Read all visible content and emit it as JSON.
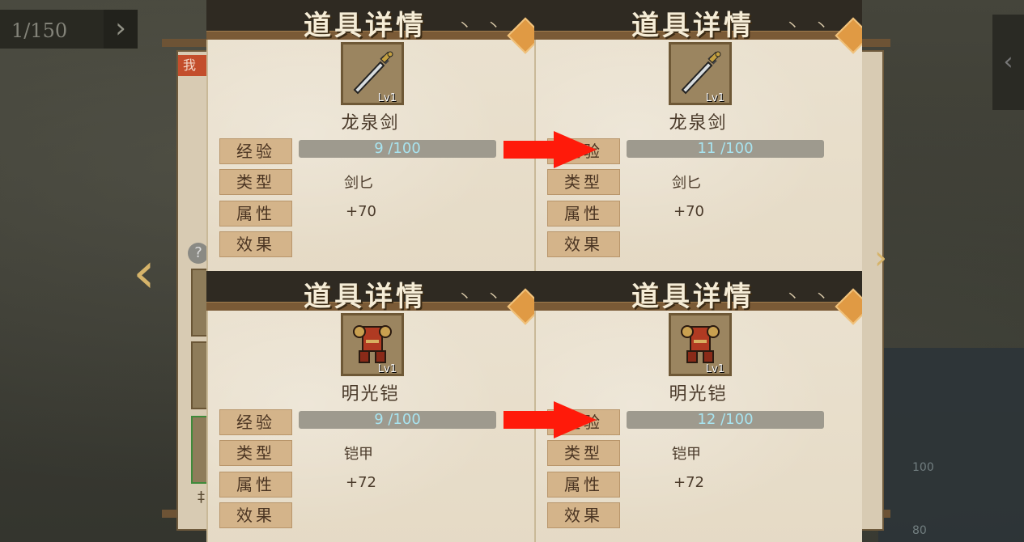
{
  "counter": {
    "text": "1/150"
  },
  "underlay": {
    "tab": "我",
    "help": "?",
    "bottom_label": "‡",
    "right_numbers": [
      "100",
      "80"
    ]
  },
  "panels": [
    {
      "title": "道具详情",
      "item": "龙泉剑",
      "level": "Lv1",
      "icon": "sword-icon",
      "rows": {
        "exp_label": "经验",
        "exp": "9 /100",
        "type_label": "类型",
        "type": "剑匕",
        "attr_label": "属性",
        "attr": "+70",
        "effect_label": "效果"
      }
    },
    {
      "title": "道具详情",
      "item": "龙泉剑",
      "level": "Lv1",
      "icon": "sword-icon",
      "rows": {
        "exp_label": "经验",
        "exp": "11 /100",
        "type_label": "类型",
        "type": "剑匕",
        "attr_label": "属性",
        "attr": "+70",
        "effect_label": "效果"
      }
    },
    {
      "title": "道具详情",
      "item": "明光铠",
      "level": "Lv1",
      "icon": "armor-icon",
      "rows": {
        "exp_label": "经验",
        "exp": "9 /100",
        "type_label": "类型",
        "type": "铠甲",
        "attr_label": "属性",
        "attr": "+72",
        "effect_label": "效果"
      }
    },
    {
      "title": "道具详情",
      "item": "明光铠",
      "level": "Lv1",
      "icon": "armor-icon",
      "rows": {
        "exp_label": "经验",
        "exp": "12 /100",
        "type_label": "类型",
        "type": "铠甲",
        "attr_label": "属性",
        "attr": "+72",
        "effect_label": "效果"
      }
    }
  ],
  "colors": {
    "annotation_arrow": "#ff1a0a",
    "header": "#2f2a22",
    "paper": "#e8dfcc",
    "label_bg": "#d4b48a"
  }
}
